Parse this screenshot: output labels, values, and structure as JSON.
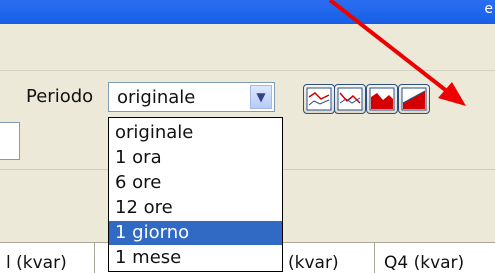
{
  "titlebar": {
    "partial_text": "e"
  },
  "toolbar": {
    "periodo_label": "Periodo",
    "select_value": "originale",
    "chart_buttons": [
      {
        "icon": "line-chart-icon"
      },
      {
        "icon": "line-chart-alt-icon"
      },
      {
        "icon": "area-chart-icon"
      },
      {
        "icon": "stacked-area-chart-icon"
      }
    ]
  },
  "dropdown": {
    "options": [
      "originale",
      "1 ora",
      "6 ore",
      "12 ore",
      "1 giorno",
      "1 mese"
    ],
    "selected_index": 4
  },
  "grid_header": {
    "columns": [
      "l (kvar)",
      "(kvar)",
      "Q4 (kvar)"
    ]
  },
  "colors": {
    "titlebar": "#155fe6",
    "selection": "#316ac5",
    "arrow": "#ee0000"
  }
}
